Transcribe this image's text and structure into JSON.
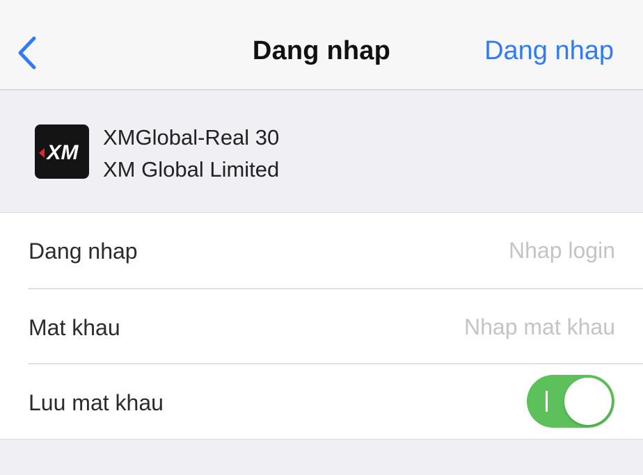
{
  "navbar": {
    "back_icon": "chevron-left-icon",
    "title": "Dang nhap",
    "action_label": "Dang nhap"
  },
  "server": {
    "logo_text": "XM",
    "name": "XMGlobal-Real 30",
    "company": "XM Global Limited"
  },
  "form": {
    "login": {
      "label": "Dang nhap",
      "value": "",
      "placeholder": "Nhap login"
    },
    "password": {
      "label": "Mat khau",
      "value": "",
      "placeholder": "Nhap mat khau"
    },
    "save_password": {
      "label": "Luu mat khau",
      "enabled": true
    }
  },
  "colors": {
    "accent": "#2f7cf6",
    "toggle_on": "#5cc15b"
  }
}
